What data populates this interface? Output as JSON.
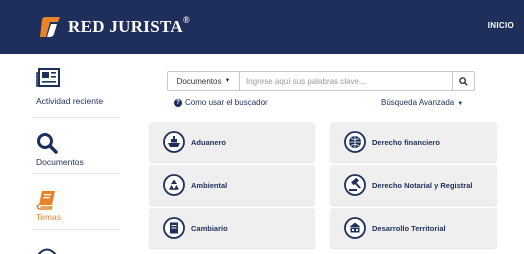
{
  "header": {
    "brand": "RED JURISTA",
    "brand_mark": "®",
    "nav_inicio": "INICIO",
    "bg_color": "#1d2f5a",
    "accent_color": "#e8832a"
  },
  "sidebar": {
    "items": [
      {
        "label": "Actividad reciente",
        "icon": "newspaper-icon",
        "active": false
      },
      {
        "label": "Documentos",
        "icon": "search-icon",
        "active": false
      },
      {
        "label": "Temas",
        "icon": "book-icon",
        "active": true
      }
    ]
  },
  "search": {
    "dropdown_label": "Documentos",
    "placeholder": "Ingrese aquí sus palabras clave...",
    "help_link": "Como usar el buscador",
    "advanced_link": "Búsqueda Avanzada"
  },
  "categories": [
    {
      "label": "Aduanero",
      "icon": "ship-icon"
    },
    {
      "label": "Derecho financiero",
      "icon": "globe-icon"
    },
    {
      "label": "Ambiental",
      "icon": "recycle-icon"
    },
    {
      "label": "Derecho Notarial y Registral",
      "icon": "gavel-icon"
    },
    {
      "label": "Cambiario",
      "icon": "document-icon"
    },
    {
      "label": "Desarrollo Territorial",
      "icon": "building-icon"
    }
  ]
}
